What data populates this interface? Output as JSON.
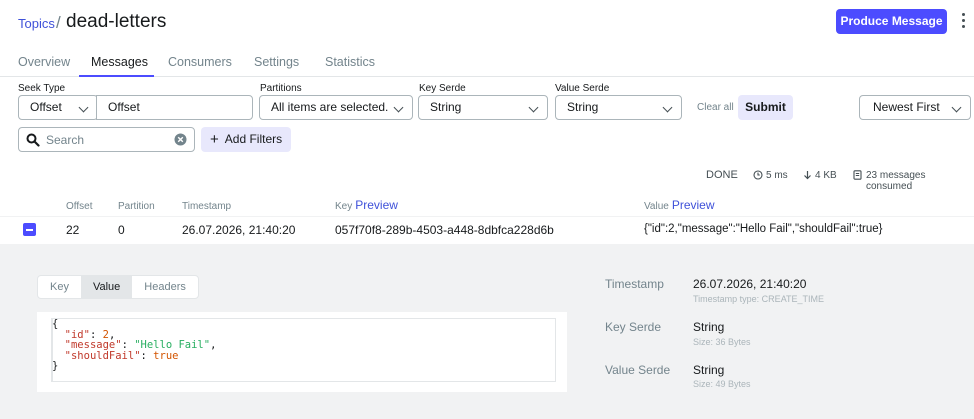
{
  "header": {
    "breadcrumb": "Topics",
    "separator": "/",
    "title": "dead-letters",
    "produce_label": "Produce Message"
  },
  "tabs": [
    {
      "label": "Overview"
    },
    {
      "label": "Messages"
    },
    {
      "label": "Consumers"
    },
    {
      "label": "Settings"
    },
    {
      "label": "Statistics"
    }
  ],
  "filters": {
    "seek_type_label": "Seek Type",
    "seek_type_value": "Offset",
    "offset_value": "Offset",
    "partitions_label": "Partitions",
    "partitions_value": "All items are selected.",
    "key_serde_label": "Key Serde",
    "key_serde_value": "String",
    "value_serde_label": "Value Serde",
    "value_serde_value": "String",
    "clear_all": "Clear all",
    "submit": "Submit",
    "sort_value": "Newest First",
    "search_placeholder": "Search",
    "add_filters": "Add Filters"
  },
  "status": {
    "state": "DONE",
    "elapsed": "5 ms",
    "bytes": "4 KB",
    "consumed": "23 messages consumed"
  },
  "table": {
    "columns": {
      "offset": "Offset",
      "partition": "Partition",
      "timestamp": "Timestamp",
      "key": "Key",
      "value": "Value",
      "preview": "Preview"
    },
    "rows": [
      {
        "offset": "22",
        "partition": "0",
        "timestamp": "26.07.2026, 21:40:20",
        "key": "057f70f8-289b-4503-a448-8dbfca228d6b",
        "value": "{\"id\":2,\"message\":\"Hello Fail\",\"shouldFail\":true}"
      }
    ]
  },
  "details": {
    "tabs": [
      "Key",
      "Value",
      "Headers"
    ],
    "json_lines": {
      "open": "{",
      "id_key": "\"id\"",
      "id_val": "2",
      "msg_key": "\"message\"",
      "msg_val": "\"Hello Fail\"",
      "fail_key": "\"shouldFail\"",
      "fail_val": "true",
      "close": "}"
    },
    "timestamp_label": "Timestamp",
    "timestamp_value": "26.07.2026, 21:40:20",
    "timestamp_type": "Timestamp type: CREATE_TIME",
    "key_serde_label": "Key Serde",
    "key_serde_value": "String",
    "key_size": "Size: 36 Bytes",
    "value_serde_label": "Value Serde",
    "value_serde_value": "String",
    "value_size": "Size: 49 Bytes"
  },
  "colors": {
    "accent": "#4c4cff",
    "link": "#3f51d9",
    "soft_accent": "#e8e8fc",
    "panel_bg": "#f1f2f3"
  }
}
